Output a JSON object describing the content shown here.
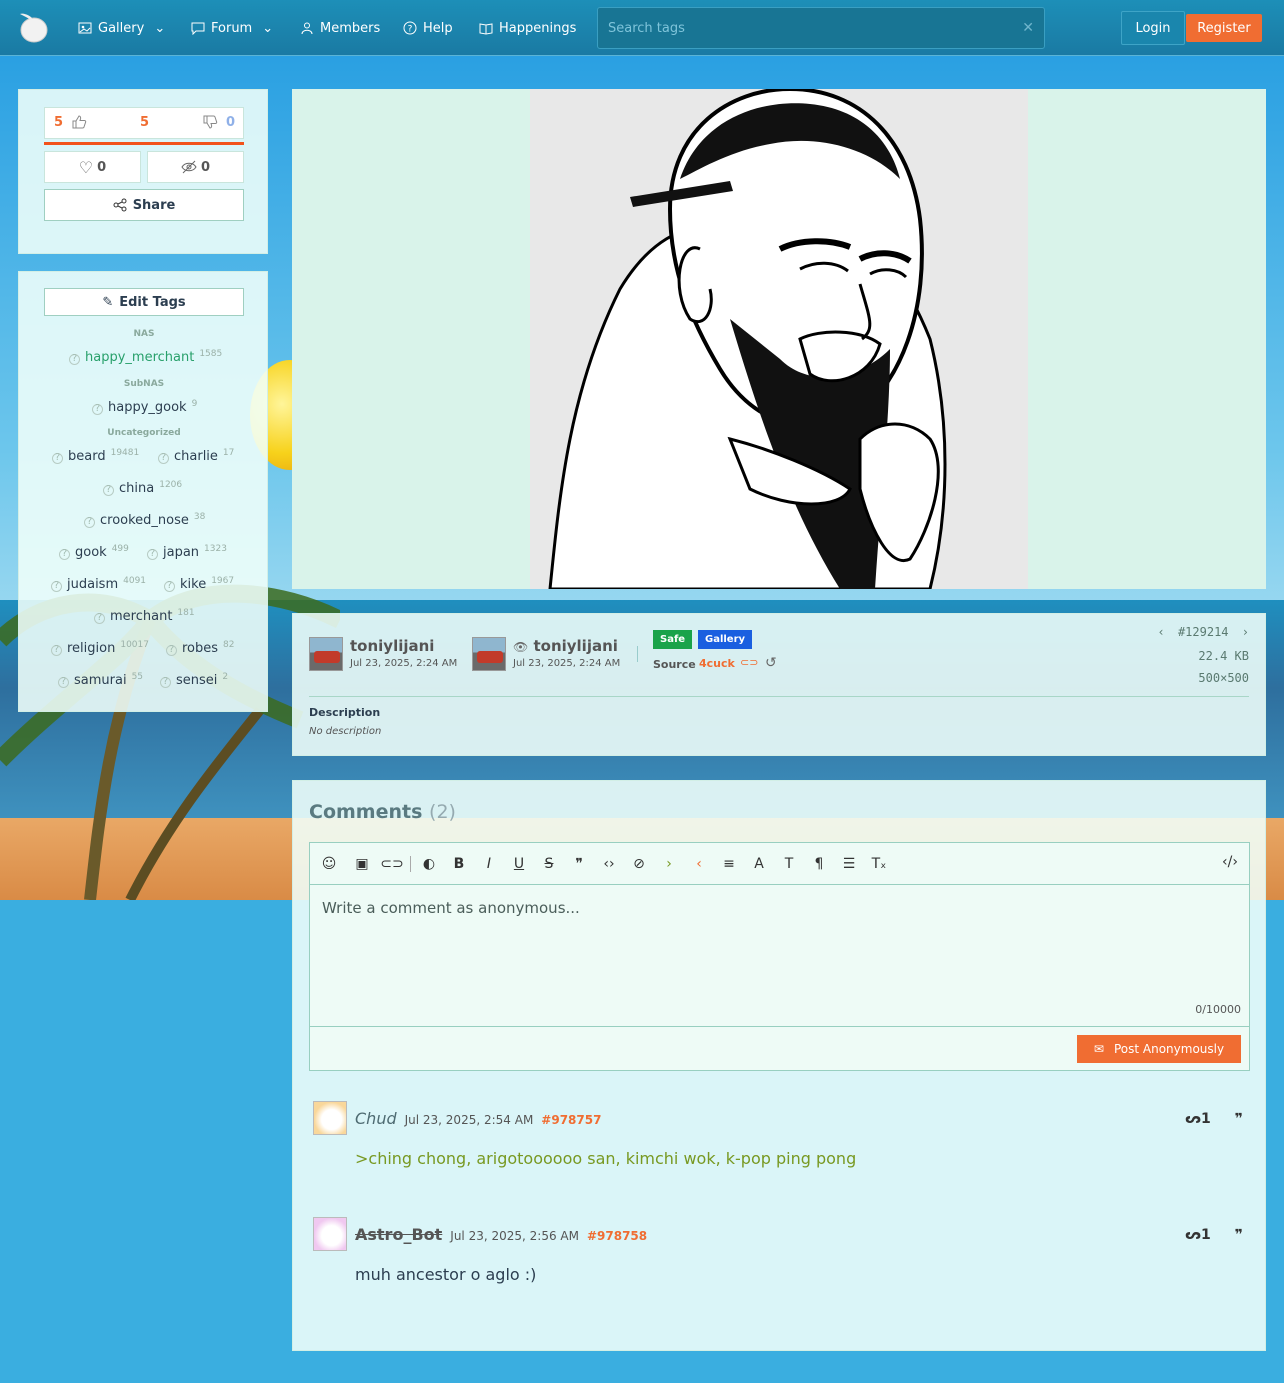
{
  "nav": {
    "items": [
      {
        "label": "Gallery",
        "icon": "gallery-icon",
        "dropdown": true
      },
      {
        "label": "Forum",
        "icon": "forum-icon",
        "dropdown": true
      },
      {
        "label": "Members",
        "icon": "members-icon",
        "dropdown": false
      },
      {
        "label": "Help",
        "icon": "help-icon",
        "dropdown": false
      },
      {
        "label": "Happenings",
        "icon": "happenings-icon",
        "dropdown": false
      }
    ],
    "search_placeholder": "Search tags",
    "login_label": "Login",
    "register_label": "Register"
  },
  "votes": {
    "upvotes": "5",
    "score": "5",
    "downvotes": "0",
    "favorites": "0",
    "hides": "0",
    "share_label": "Share"
  },
  "tags": {
    "edit_label": "Edit Tags",
    "categories": [
      {
        "name": "NAS",
        "items": [
          {
            "name": "happy_merchant",
            "count": "1585"
          }
        ]
      },
      {
        "name": "SubNAS",
        "items": [
          {
            "name": "happy_gook",
            "count": "9"
          }
        ]
      },
      {
        "name": "Uncategorized",
        "items": [
          {
            "name": "beard",
            "count": "19481"
          },
          {
            "name": "charlie",
            "count": "17"
          },
          {
            "name": "china",
            "count": "1206"
          },
          {
            "name": "crooked_nose",
            "count": "38"
          },
          {
            "name": "gook",
            "count": "499"
          },
          {
            "name": "japan",
            "count": "1323"
          },
          {
            "name": "judaism",
            "count": "4091"
          },
          {
            "name": "kike",
            "count": "1967"
          },
          {
            "name": "merchant",
            "count": "181"
          },
          {
            "name": "religion",
            "count": "10017"
          },
          {
            "name": "robes",
            "count": "82"
          },
          {
            "name": "samurai",
            "count": "55"
          },
          {
            "name": "sensei",
            "count": "2"
          }
        ]
      }
    ]
  },
  "info": {
    "uploader": {
      "name": "toniylijani",
      "date": "Jul 23, 2025, 2:24 AM"
    },
    "approver": {
      "name": "toniylijani",
      "date": "Jul 23, 2025, 2:24 AM"
    },
    "rating_badge": "Safe",
    "section_badge": "Gallery",
    "source_label": "Source",
    "source_value": "4cuck",
    "post_id": "#129214",
    "file_size": "22.4 KB",
    "dimensions": "500×500",
    "description_title": "Description",
    "description_value": "No description"
  },
  "comments": {
    "title": "Comments",
    "count": "(2)",
    "placeholder": "Write a comment as anonymous...",
    "char_count": "0/10000",
    "post_label": "Post Anonymously",
    "list": [
      {
        "author": "Chud",
        "date": "Jul 23, 2025, 2:54 AM",
        "id": "#978757",
        "body": ">ching chong, arigotoooooo san, kimchi wok, k-pop ping pong"
      },
      {
        "author": "Astro_Bot",
        "date": "Jul 23, 2025, 2:56 AM",
        "id": "#978758",
        "body": "muh ancestor o aglo :)"
      }
    ]
  },
  "colors": {
    "accent": "#f06d32",
    "nav": "#1a86ad",
    "safe": "#1aa34a",
    "gallery_badge": "#1a5fe0",
    "greentext": "#789922"
  }
}
